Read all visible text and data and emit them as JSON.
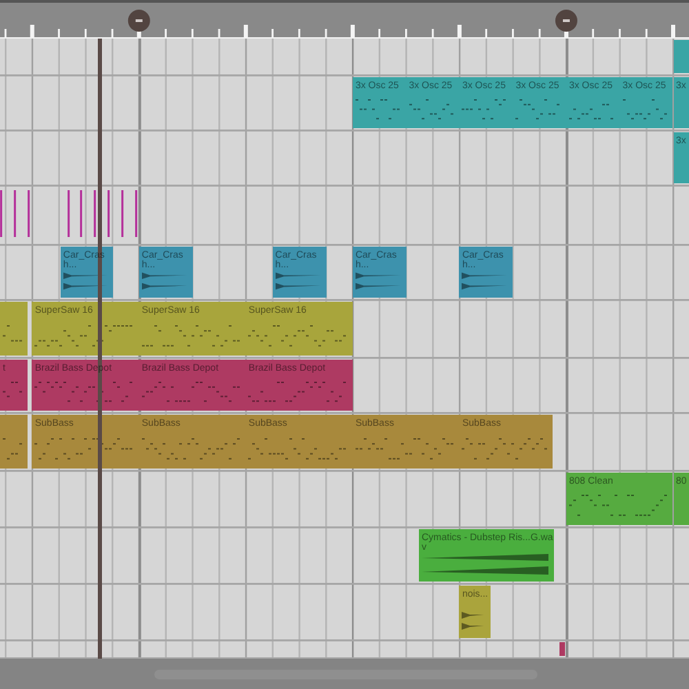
{
  "tracks": [
    {
      "clips": [
        {
          "kind": "pattern",
          "color": "#3aa5a5"
        }
      ]
    },
    {
      "clips": [
        {
          "kind": "pattern",
          "label": "3x Osc 25",
          "color": "#3aa5a5"
        },
        {
          "kind": "pattern",
          "label": "3x Osc 25",
          "color": "#3aa5a5"
        },
        {
          "kind": "pattern",
          "label": "3x Osc 25",
          "color": "#3aa5a5"
        },
        {
          "kind": "pattern",
          "label": "3x Osc 25",
          "color": "#3aa5a5"
        },
        {
          "kind": "pattern",
          "label": "3x Osc 25",
          "color": "#3aa5a5"
        },
        {
          "kind": "pattern",
          "label": "3x Osc 25",
          "color": "#3aa5a5"
        },
        {
          "kind": "pattern",
          "label": "3x",
          "color": "#3aa5a5"
        }
      ]
    },
    {
      "clips": [
        {
          "kind": "pattern",
          "label": "3x",
          "color": "#3aa5a5"
        }
      ]
    },
    {
      "clips": [
        {
          "kind": "notes",
          "color": "#b4309a"
        }
      ]
    },
    {
      "clips": [
        {
          "kind": "audio",
          "label": "Car_Crash...",
          "color": "#3d92ad"
        },
        {
          "kind": "audio",
          "label": "Car_Crash...",
          "color": "#3d92ad"
        },
        {
          "kind": "audio",
          "label": "Car_Crash...",
          "color": "#3d92ad"
        },
        {
          "kind": "audio",
          "label": "Car_Crash...",
          "color": "#3d92ad"
        },
        {
          "kind": "audio",
          "label": "Car_Crash...",
          "color": "#3d92ad"
        }
      ]
    },
    {
      "clips": [
        {
          "kind": "pattern",
          "color": "#a8a53c"
        },
        {
          "kind": "pattern",
          "label": "SuperSaw 16",
          "color": "#a8a53c"
        },
        {
          "kind": "pattern",
          "label": "SuperSaw 16",
          "color": "#a8a53c"
        },
        {
          "kind": "pattern",
          "label": "SuperSaw 16",
          "color": "#a8a53c"
        }
      ]
    },
    {
      "clips": [
        {
          "kind": "pattern",
          "label": "t",
          "color": "#ae3a62"
        },
        {
          "kind": "pattern",
          "label": "Brazil Bass Depot",
          "color": "#ae3a62"
        },
        {
          "kind": "pattern",
          "label": "Brazil Bass Depot",
          "color": "#ae3a62"
        },
        {
          "kind": "pattern",
          "label": "Brazil Bass Depot",
          "color": "#ae3a62"
        }
      ]
    },
    {
      "clips": [
        {
          "kind": "pattern",
          "color": "#a8893c"
        },
        {
          "kind": "pattern",
          "label": "SubBass",
          "color": "#a8893c"
        },
        {
          "kind": "pattern",
          "label": "SubBass",
          "color": "#a8893c"
        },
        {
          "kind": "pattern",
          "label": "SubBass",
          "color": "#a8893c"
        },
        {
          "kind": "pattern",
          "label": "SubBass",
          "color": "#a8893c"
        },
        {
          "kind": "pattern",
          "label": "SubBass",
          "color": "#a8893c"
        }
      ]
    },
    {
      "clips": [
        {
          "kind": "pattern",
          "label": "808 Clean",
          "color": "#56ab40"
        },
        {
          "kind": "pattern",
          "label": "80",
          "color": "#56ab40"
        }
      ]
    },
    {
      "clips": [
        {
          "kind": "audio",
          "label": "Cymatics - Dubstep Ris...G.wav",
          "color": "#4aae3e"
        }
      ]
    },
    {
      "clips": [
        {
          "kind": "audio",
          "label": "nois...",
          "color": "#aaa43c"
        }
      ]
    },
    {
      "clips": [
        {
          "kind": "pattern",
          "color": "#ae3a62"
        }
      ]
    }
  ]
}
